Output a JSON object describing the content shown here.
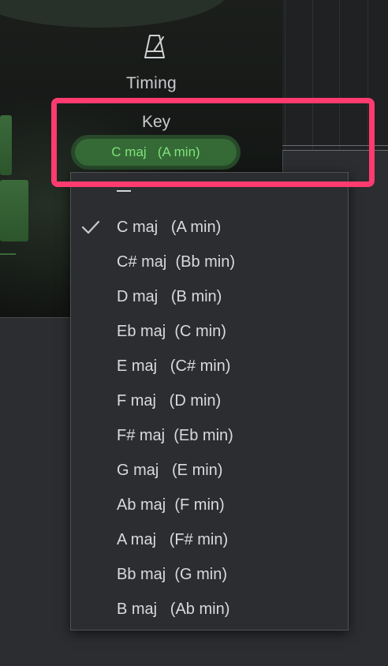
{
  "timing": {
    "label": "Timing",
    "icon": "metronome-icon"
  },
  "key": {
    "label": "Key",
    "selected": "C maj   (A min)"
  },
  "menu": {
    "items": [
      {
        "label": "C maj   (A min)",
        "checked": true
      },
      {
        "label": "C# maj  (Bb min)",
        "checked": false
      },
      {
        "label": "D maj   (B min)",
        "checked": false
      },
      {
        "label": "Eb maj  (C min)",
        "checked": false
      },
      {
        "label": "E maj   (C# min)",
        "checked": false
      },
      {
        "label": "F maj   (D min)",
        "checked": false
      },
      {
        "label": "F# maj  (Eb min)",
        "checked": false
      },
      {
        "label": "G maj   (E min)",
        "checked": false
      },
      {
        "label": "Ab maj  (F min)",
        "checked": false
      },
      {
        "label": "A maj   (F# min)",
        "checked": false
      },
      {
        "label": "Bb maj  (G min)",
        "checked": false
      },
      {
        "label": "B maj   (Ab min)",
        "checked": false
      }
    ]
  },
  "colors": {
    "highlight": "#ff3b6f",
    "key_text": "#7ee277",
    "key_fill": "#356a37"
  }
}
